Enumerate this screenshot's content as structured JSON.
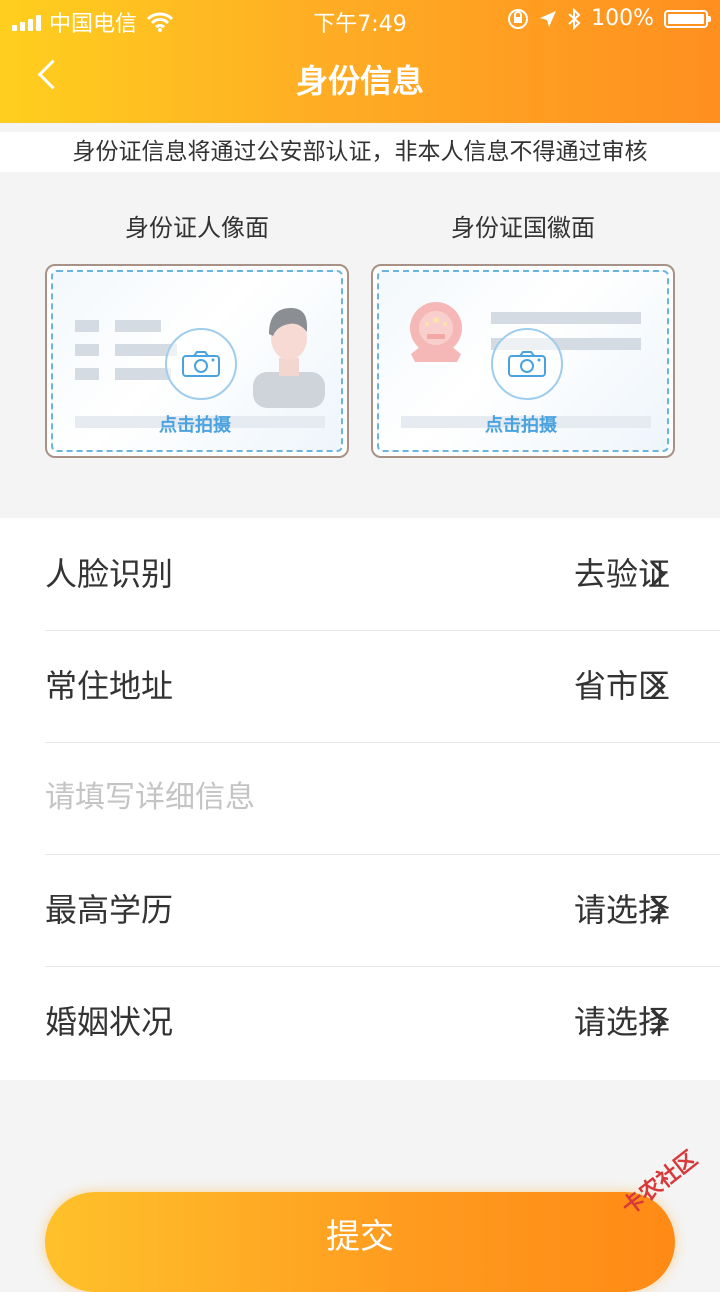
{
  "status_bar": {
    "carrier": "中国电信",
    "time": "下午7:49",
    "battery": "100%",
    "battery_level": 1.0,
    "signal_bars": 4
  },
  "nav": {
    "title": "身份信息"
  },
  "notice": "身份证信息将通过公安部认证，非本人信息不得通过审核",
  "id_cards": {
    "front_label": "身份证人像面",
    "back_label": "身份证国徽面",
    "tap_text": "点击拍摄"
  },
  "form": {
    "face_label": "人脸识别",
    "face_value": "去验证",
    "address_label": "常住地址",
    "address_value": "省市区",
    "detail_placeholder": "请填写详细信息",
    "education_label": "最高学历",
    "education_value": "请选择",
    "marital_label": "婚姻状况",
    "marital_value": "请选择"
  },
  "submit_label": "提交",
  "watermark": "卡农社区",
  "colors": {
    "header_start": "#ffcf1e",
    "header_end": "#ff8f1f",
    "accent_blue": "#4aa3df"
  }
}
